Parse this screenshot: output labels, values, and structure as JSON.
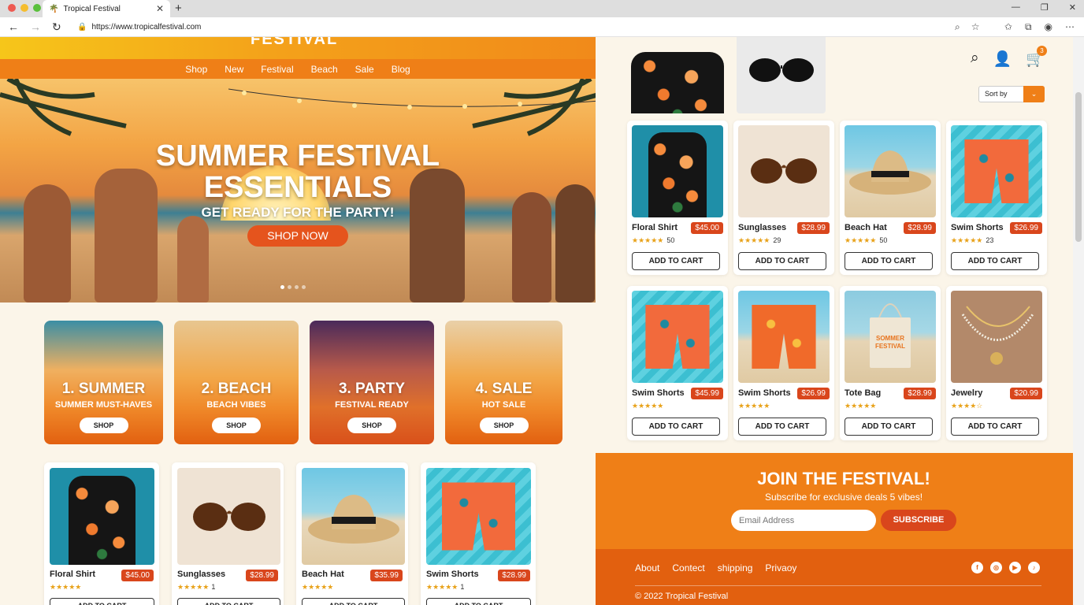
{
  "browser": {
    "tab_title": "Tropical Festival",
    "url": "https://www.tropicalfestival.com"
  },
  "site": {
    "logo": "FESTIVAL",
    "nav": [
      "Shop",
      "New",
      "Festival",
      "Beach",
      "Sale",
      "Blog"
    ]
  },
  "hero": {
    "title_line1": "SUMMER FESTIVAL",
    "title_line2": "ESSENTIALS",
    "subtitle": "GET READY FOR THE PARTY!",
    "cta": "SHOP NOW"
  },
  "categories": [
    {
      "num": "1. SUMMER",
      "sub": "SUMMER MUST-HAVES",
      "btn": "SHOP"
    },
    {
      "num": "2. BEACH",
      "sub": "BEACH VIBES",
      "btn": "SHOP"
    },
    {
      "num": "3. PARTY",
      "sub": "FESTIVAL READY",
      "btn": "SHOP"
    },
    {
      "num": "4. SALE",
      "sub": "HOT SALE",
      "btn": "SHOP"
    }
  ],
  "left_products": [
    {
      "name": "Floral Shirt",
      "price": "$45.00",
      "stars": "★★★★★",
      "count": "",
      "btn": "ADD TO CART"
    },
    {
      "name": "Sunglasses",
      "price": "$28.99",
      "stars": "★★★★★",
      "count": "1",
      "btn": "ADD TO CART"
    },
    {
      "name": "Beach Hat",
      "price": "$35.99",
      "stars": "★★★★★",
      "count": "",
      "btn": "ADD TO CART"
    },
    {
      "name": "Swim Shorts",
      "price": "$28.99",
      "stars": "★★★★★",
      "count": "1",
      "btn": "ADD TO CART"
    }
  ],
  "header_icons": {
    "cart_count": "3"
  },
  "sort": {
    "label": "Sort by"
  },
  "right_products": [
    {
      "name": "Floral Shirt",
      "price": "$45.00",
      "stars": "★★★★★",
      "count": "50",
      "btn": "ADD TO CART"
    },
    {
      "name": "Sunglasses",
      "price": "$28.99",
      "stars": "★★★★★",
      "count": "29",
      "btn": "ADD TO CART"
    },
    {
      "name": "Beach Hat",
      "price": "$28.99",
      "stars": "★★★★★",
      "count": "50",
      "btn": "ADD TO CART"
    },
    {
      "name": "Swim Shorts",
      "price": "$26.99",
      "stars": "★★★★★",
      "count": "23",
      "btn": "ADD TO CART"
    },
    {
      "name": "Swim Shorts",
      "price": "$45.99",
      "stars": "★★★★★",
      "count": "",
      "btn": "ADD TO CART"
    },
    {
      "name": "Swim Shorts",
      "price": "$26.99",
      "stars": "★★★★★",
      "count": "",
      "btn": "ADD TO CART"
    },
    {
      "name": "Tote Bag",
      "price": "$28.99",
      "stars": "★★★★★",
      "count": "",
      "btn": "ADD TO CART"
    },
    {
      "name": "Jewelry",
      "price": "$20.99",
      "stars": "★★★★☆",
      "count": "",
      "btn": "ADD TO CART"
    }
  ],
  "tote_print": "SOMMER FESTIVAL",
  "newsletter": {
    "title": "JOIN THE FESTIVAL!",
    "subtitle": "Subscribe for exclusive deals 5 vibes!",
    "placeholder": "Email Address",
    "button": "SUBSCRIBE"
  },
  "footer": {
    "links": [
      "About",
      "Contect",
      "shipping",
      "Privaoy"
    ],
    "copyright": "© 2022 Tropical Festival"
  },
  "colors": {
    "accent": "#ef7f17",
    "price_badge": "#d9461c",
    "footer": "#e2600f"
  }
}
